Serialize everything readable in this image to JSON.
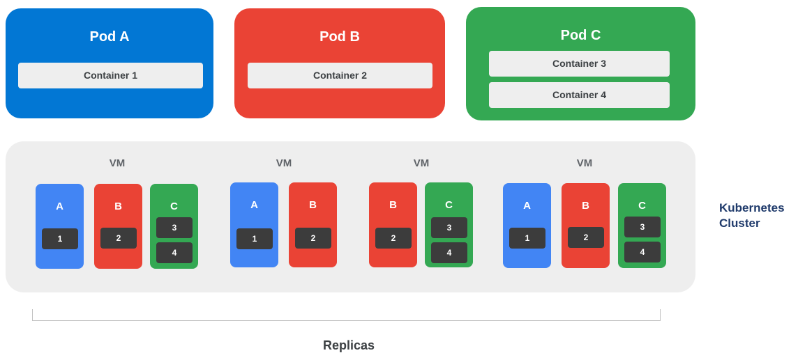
{
  "pods": [
    {
      "name": "Pod A",
      "containers": [
        "Container 1"
      ],
      "color": "#0277d4"
    },
    {
      "name": "Pod B",
      "containers": [
        "Container 2"
      ],
      "color": "#ea4335"
    },
    {
      "name": "Pod C",
      "containers": [
        "Container 3",
        "Container 4"
      ],
      "color": "#34a853"
    }
  ],
  "cluster": {
    "label_line1": "Kubernetes",
    "label_line2": "Cluster",
    "vms": [
      {
        "label": "VM",
        "pods": [
          {
            "letter": "A",
            "color": "blue",
            "chips": [
              "1"
            ]
          },
          {
            "letter": "B",
            "color": "red",
            "chips": [
              "2"
            ]
          },
          {
            "letter": "C",
            "color": "green",
            "chips": [
              "3",
              "4"
            ]
          }
        ]
      },
      {
        "label": "VM",
        "pods": [
          {
            "letter": "A",
            "color": "blue",
            "chips": [
              "1"
            ]
          },
          {
            "letter": "B",
            "color": "red",
            "chips": [
              "2"
            ]
          }
        ]
      },
      {
        "label": "VM",
        "pods": [
          {
            "letter": "B",
            "color": "red",
            "chips": [
              "2"
            ]
          },
          {
            "letter": "C",
            "color": "green",
            "chips": [
              "3",
              "4"
            ]
          }
        ]
      },
      {
        "label": "VM",
        "pods": [
          {
            "letter": "A",
            "color": "blue",
            "chips": [
              "1"
            ]
          },
          {
            "letter": "B",
            "color": "red",
            "chips": [
              "2"
            ]
          },
          {
            "letter": "C",
            "color": "green",
            "chips": [
              "3",
              "4"
            ]
          }
        ]
      }
    ]
  },
  "replicas_label": "Replicas",
  "colors": {
    "blue": "#4285f4",
    "red": "#ea4335",
    "green": "#34a853",
    "cluster_bg": "#eeeeee",
    "chip": "#3c3c3c",
    "cluster_label": "#1f3a6b"
  }
}
